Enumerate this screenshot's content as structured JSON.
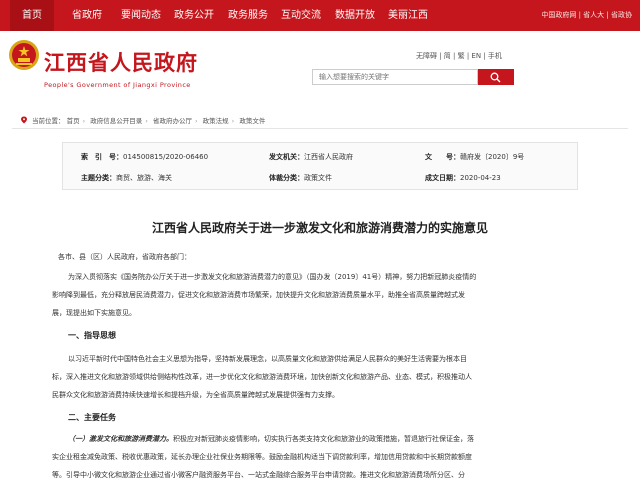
{
  "nav": {
    "items": [
      "首页",
      "省政府",
      "要闻动态",
      "政务公开",
      "政务服务",
      "互动交流",
      "数据开放",
      "美丽江西"
    ],
    "right": "中国政府网 | 省人大 | 省政协"
  },
  "header": {
    "title": "江西省人民政府",
    "subtitle": "People's Government of Jiangxi Province",
    "lang_links": "无障碍 | 简 | 繁 | EN | 手机",
    "search_placeholder": "输入想要搜索的关键字"
  },
  "breadcrumb": {
    "label": "当前位置：",
    "items": [
      "首页",
      "政府信息公开目录",
      "省政府办公厅",
      "政策法规",
      "政策文件"
    ]
  },
  "meta": {
    "index_label": "索　引　号：",
    "index_value": "014500815/2020-06460",
    "issuer_label": "发文机关：",
    "issuer_value": "江西省人民政府",
    "docno_label": "文　　号：",
    "docno_value": "赣府发〔2020〕9号",
    "topic_label": "主题分类：",
    "topic_value": "商贸、旅游、海关",
    "type_label": "体裁分类：",
    "type_value": "政策文件",
    "date_label": "成文日期：",
    "date_value": "2020-04-23"
  },
  "document": {
    "title": "江西省人民政府关于进一步激发文化和旅游消费潜力的实施意见",
    "salutation": "各市、县（区）人民政府，省政府各部门：",
    "intro_1": "为深入贯彻落实《国务院办公厅关于进一步激发文化和旅游消费潜力的意见》（国办发〔2019〕41号）精神，努力把新冠肺炎疫情的",
    "intro_2": "影响降到最低，充分释放居民消费潜力，促进文化和旅游消费市场繁荣，加快提升文化和旅游消费质量水平，助推全省高质量跨越式发",
    "intro_3": "展，现提出如下实施意见。",
    "section_1": "一、指导思想",
    "guide_1": "以习近平新时代中国特色社会主义思想为指导，坚持新发展理念，以高质量文化和旅游供给满足人民群众的美好生活需要为根本目",
    "guide_2": "标，深入推进文化和旅游领域供给侧结构性改革，进一步优化文化和旅游消费环境，加快创新文化和旅游产品、业态、模式，积极推动人",
    "guide_3": "民群众文化和旅游消费持续快速增长和提档升级，为全省高质量跨越式发展提供强有力支撑。",
    "section_2": "二、主要任务",
    "task_lead": "（一）激发文化和旅游消费潜力。",
    "task_1_rest": "积极应对新冠肺炎疫情影响，切实执行各类支持文化和旅游业的政策措施，暂退旅行社保证金，落",
    "task_2": "实企业租金减免政策、税收优惠政策，延长办理企业社保业务期限等。鼓励金融机构适当下调贷款利率，增加信用贷款和中长期贷款额度",
    "task_3": "等。引导中小微文化和旅游企业通过省小微客户融资服务平台、一站式金融综合服务平台申请贷款。推进文化和旅游消费场所分区、分"
  }
}
